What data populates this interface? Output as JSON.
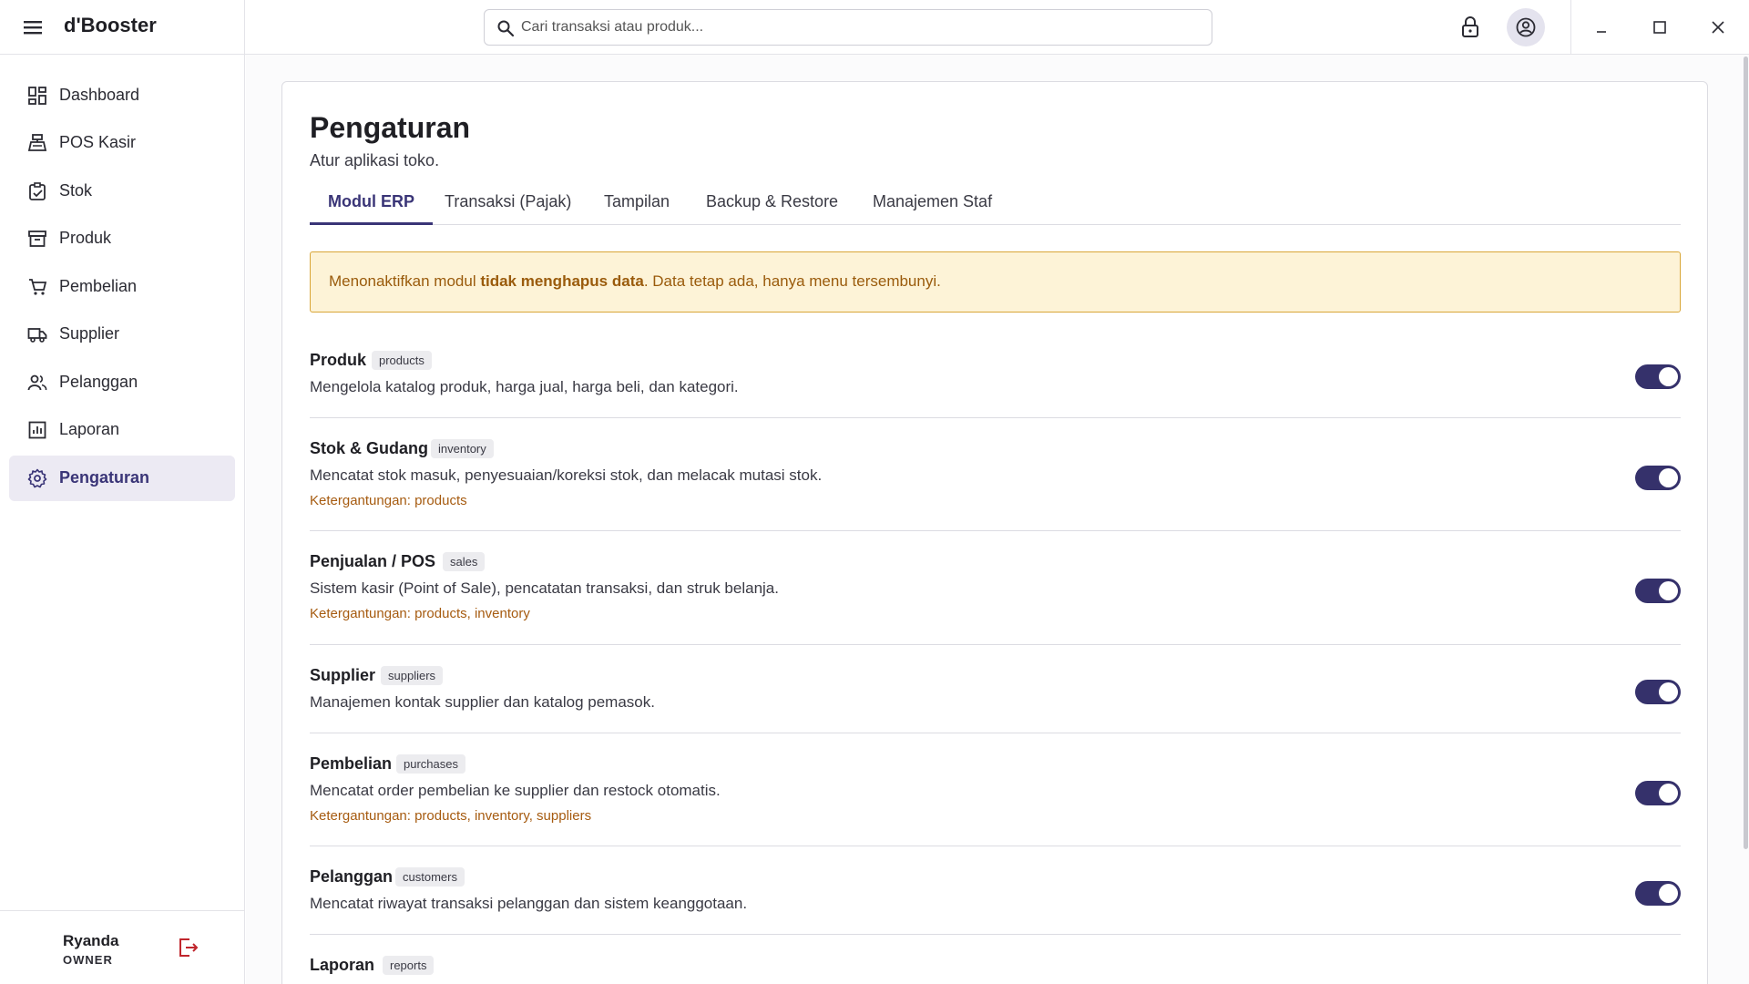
{
  "app": {
    "title": "d'Booster"
  },
  "search": {
    "placeholder": "Cari transaksi atau produk..."
  },
  "sidebar": {
    "items": [
      {
        "label": "Dashboard",
        "icon": "dashboard-icon"
      },
      {
        "label": "POS Kasir",
        "icon": "cashier-icon"
      },
      {
        "label": "Stok",
        "icon": "inventory-icon"
      },
      {
        "label": "Produk",
        "icon": "archive-icon"
      },
      {
        "label": "Pembelian",
        "icon": "cart-icon"
      },
      {
        "label": "Supplier",
        "icon": "truck-icon"
      },
      {
        "label": "Pelanggan",
        "icon": "people-icon"
      },
      {
        "label": "Laporan",
        "icon": "report-icon"
      },
      {
        "label": "Pengaturan",
        "icon": "gear-icon",
        "active": true
      }
    ],
    "user": {
      "name": "Ryanda",
      "role": "OWNER"
    }
  },
  "page": {
    "title": "Pengaturan",
    "subtitle": "Atur aplikasi toko.",
    "tabs": [
      {
        "label": "Modul ERP",
        "active": true
      },
      {
        "label": "Transaksi (Pajak)"
      },
      {
        "label": "Tampilan"
      },
      {
        "label": "Backup & Restore"
      },
      {
        "label": "Manajemen Staf"
      }
    ],
    "alert": {
      "prefix": "Menonaktifkan modul ",
      "bold": "tidak menghapus data",
      "suffix": ". Data tetap ada, hanya menu tersembunyi."
    }
  },
  "modules": [
    {
      "name": "Produk",
      "code": "products",
      "desc": "Mengelola katalog produk, harga jual, harga beli, dan kategori.",
      "dep": "",
      "enabled": true
    },
    {
      "name": "Stok & Gudang",
      "code": "inventory",
      "desc": "Mencatat stok masuk, penyesuaian/koreksi stok, dan melacak mutasi stok.",
      "dep": "Ketergantungan: products",
      "enabled": true
    },
    {
      "name": "Penjualan / POS",
      "code": "sales",
      "desc": "Sistem kasir (Point of Sale), pencatatan transaksi, dan struk belanja.",
      "dep": "Ketergantungan: products, inventory",
      "enabled": true
    },
    {
      "name": "Supplier",
      "code": "suppliers",
      "desc": "Manajemen kontak supplier dan katalog pemasok.",
      "dep": "",
      "enabled": true
    },
    {
      "name": "Pembelian",
      "code": "purchases",
      "desc": "Mencatat order pembelian ke supplier dan restock otomatis.",
      "dep": "Ketergantungan: products, inventory, suppliers",
      "enabled": true
    },
    {
      "name": "Pelanggan",
      "code": "customers",
      "desc": "Mencatat riwayat transaksi pelanggan dan sistem keanggotaan.",
      "dep": "",
      "enabled": true
    },
    {
      "name": "Laporan",
      "code": "reports",
      "desc": "",
      "dep": "",
      "enabled": true
    }
  ],
  "colors": {
    "accent": "#35316b",
    "alert_bg": "#fdf3d7",
    "alert_border": "#d9a637",
    "dependency": "#a65b10"
  }
}
